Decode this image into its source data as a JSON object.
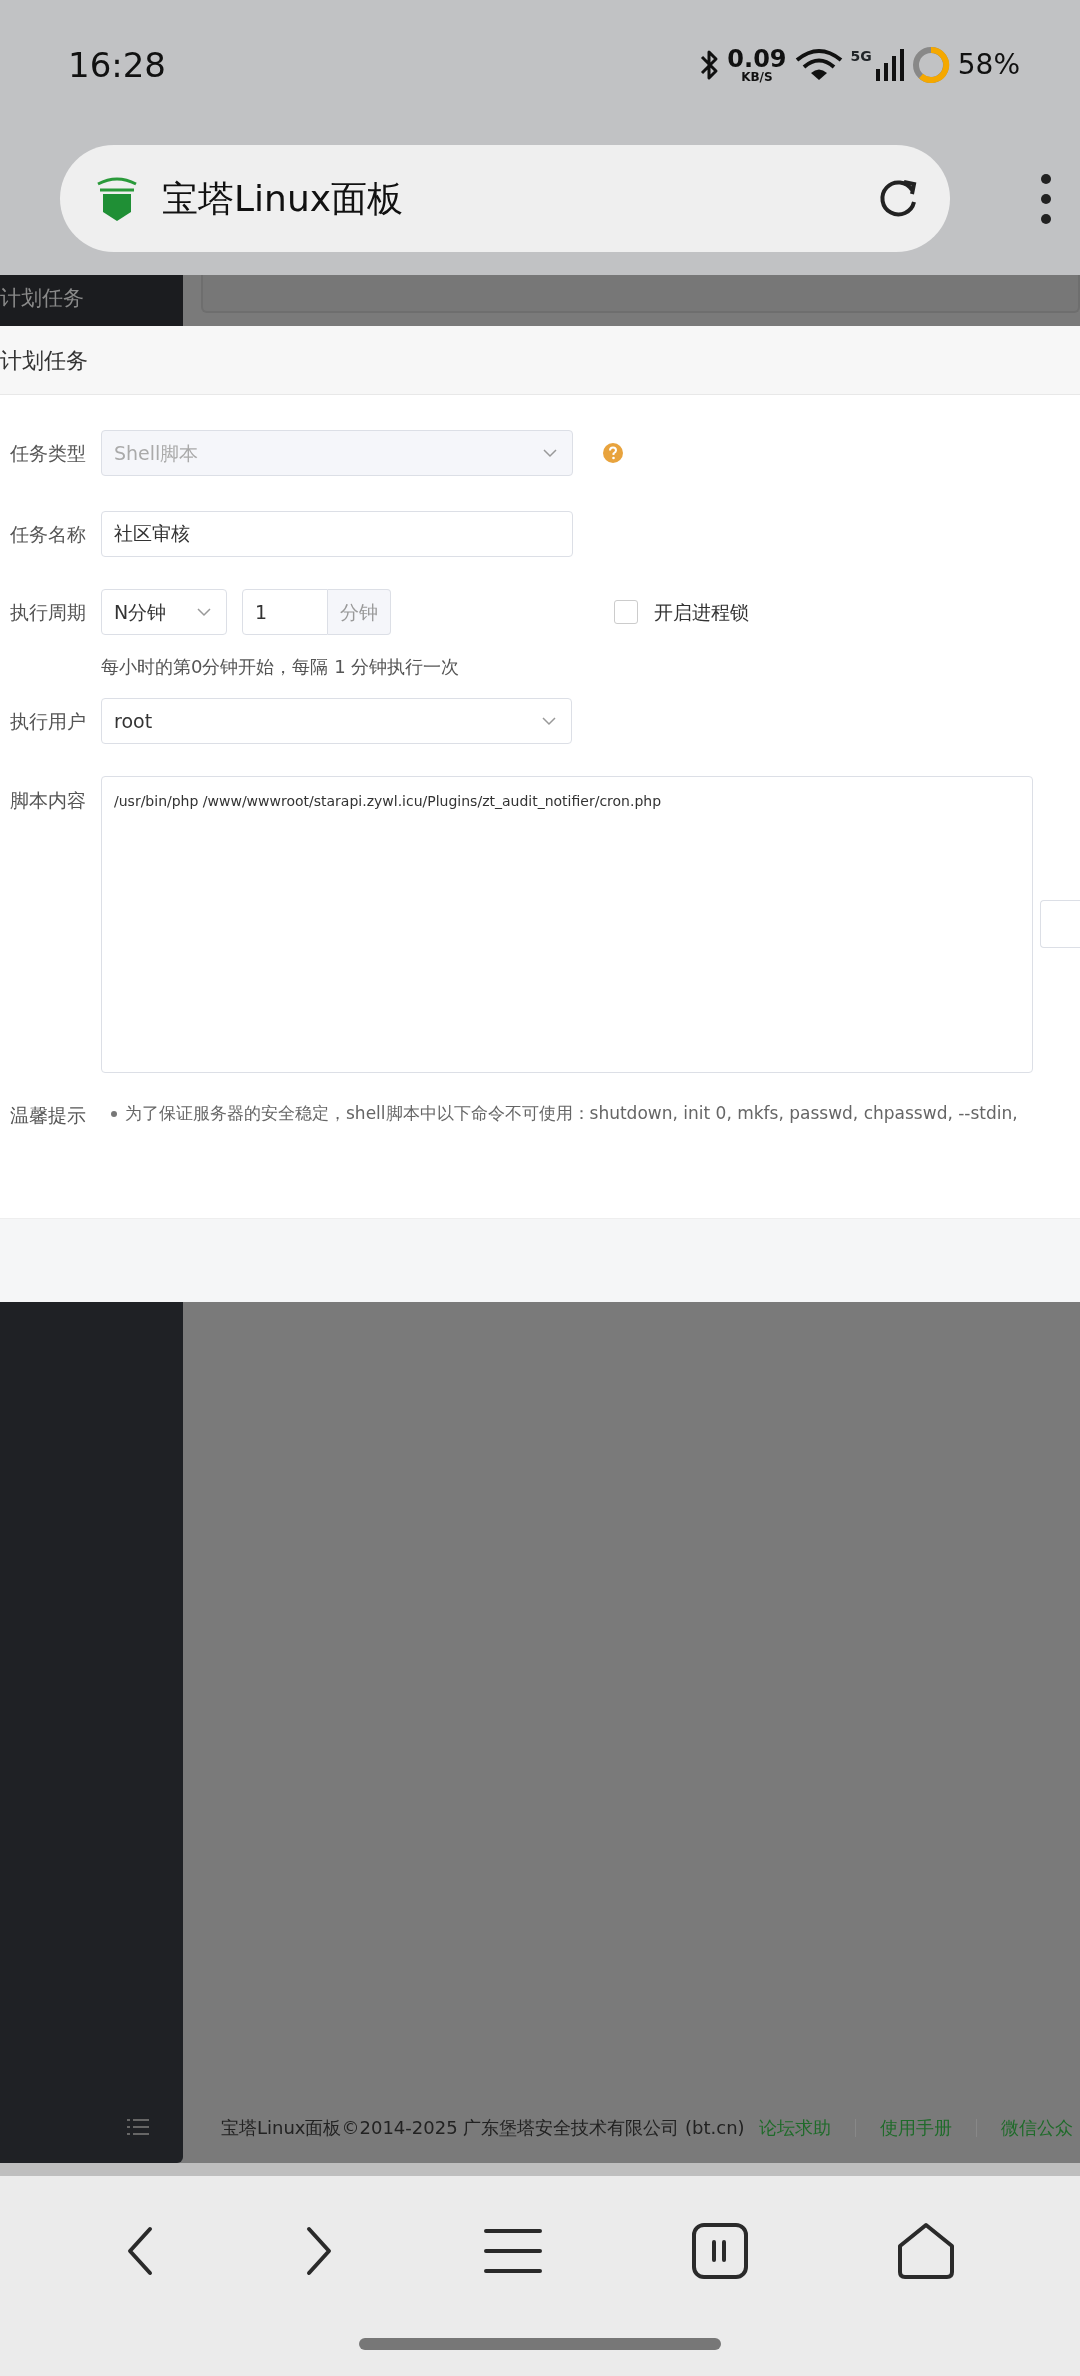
{
  "status_bar": {
    "time": "16:28",
    "network_speed": "0.09",
    "speed_unit": "KB/S",
    "network_type": "5G",
    "battery": "58%"
  },
  "browser": {
    "title": "宝塔Linux面板"
  },
  "background_page": {
    "sidebar_item": "计划任务"
  },
  "dialog": {
    "title": "计划任务",
    "task_type": {
      "label": "任务类型",
      "value": "Shell脚本",
      "disabled": true
    },
    "task_name": {
      "label": "任务名称",
      "value": "社区审核"
    },
    "period": {
      "label": "执行周期",
      "unit": "N分钟",
      "minutes": "1",
      "addon": "分钟",
      "lock": {
        "label": "开启进程锁",
        "checked": false
      },
      "hint": "每小时的第0分钟开始，每隔 1 分钟执行一次"
    },
    "user": {
      "label": "执行用户",
      "value": "root"
    },
    "script": {
      "label": "脚本内容",
      "value": "/usr/bin/php /www/wwwroot/starapi.zywl.icu/Plugins/zt_audit_notifier/cron.php"
    },
    "tips": {
      "label": "温馨提示",
      "items": [
        "为了保证服务器的安全稳定，shell脚本中以下命令不可使用：shutdown, init 0, mkfs, passwd, chpasswd, --stdin,"
      ]
    }
  },
  "footer": {
    "copyright": "宝塔Linux面板©2014-2025 广东堡塔安全技术有限公司 (bt.cn)",
    "links": [
      "论坛求助",
      "使用手册",
      "微信公众"
    ]
  }
}
